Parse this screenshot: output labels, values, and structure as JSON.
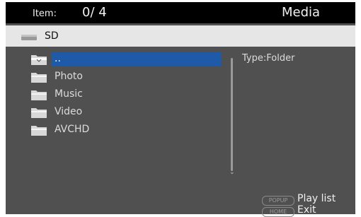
{
  "header": {
    "item_label": "Item:",
    "item_count": "0/ 4",
    "title": "Media"
  },
  "path": {
    "icon": "drive-icon",
    "label": "SD"
  },
  "files": [
    {
      "label": "..",
      "icon": "parent-folder-icon",
      "selected": true
    },
    {
      "label": "Photo",
      "icon": "folder-icon",
      "selected": false
    },
    {
      "label": "Music",
      "icon": "folder-icon",
      "selected": false
    },
    {
      "label": "Video",
      "icon": "folder-icon",
      "selected": false
    },
    {
      "label": "AVCHD",
      "icon": "folder-icon",
      "selected": false
    }
  ],
  "info": {
    "type": "Type:Folder"
  },
  "hints": [
    {
      "key": "POPUP",
      "label": "Play list"
    },
    {
      "key": "HOME",
      "label": "Exit"
    }
  ],
  "colors": {
    "background": "#505050",
    "header": "#000000",
    "path_bar": "#e6e6e6",
    "selection": "#1e5aa8"
  }
}
